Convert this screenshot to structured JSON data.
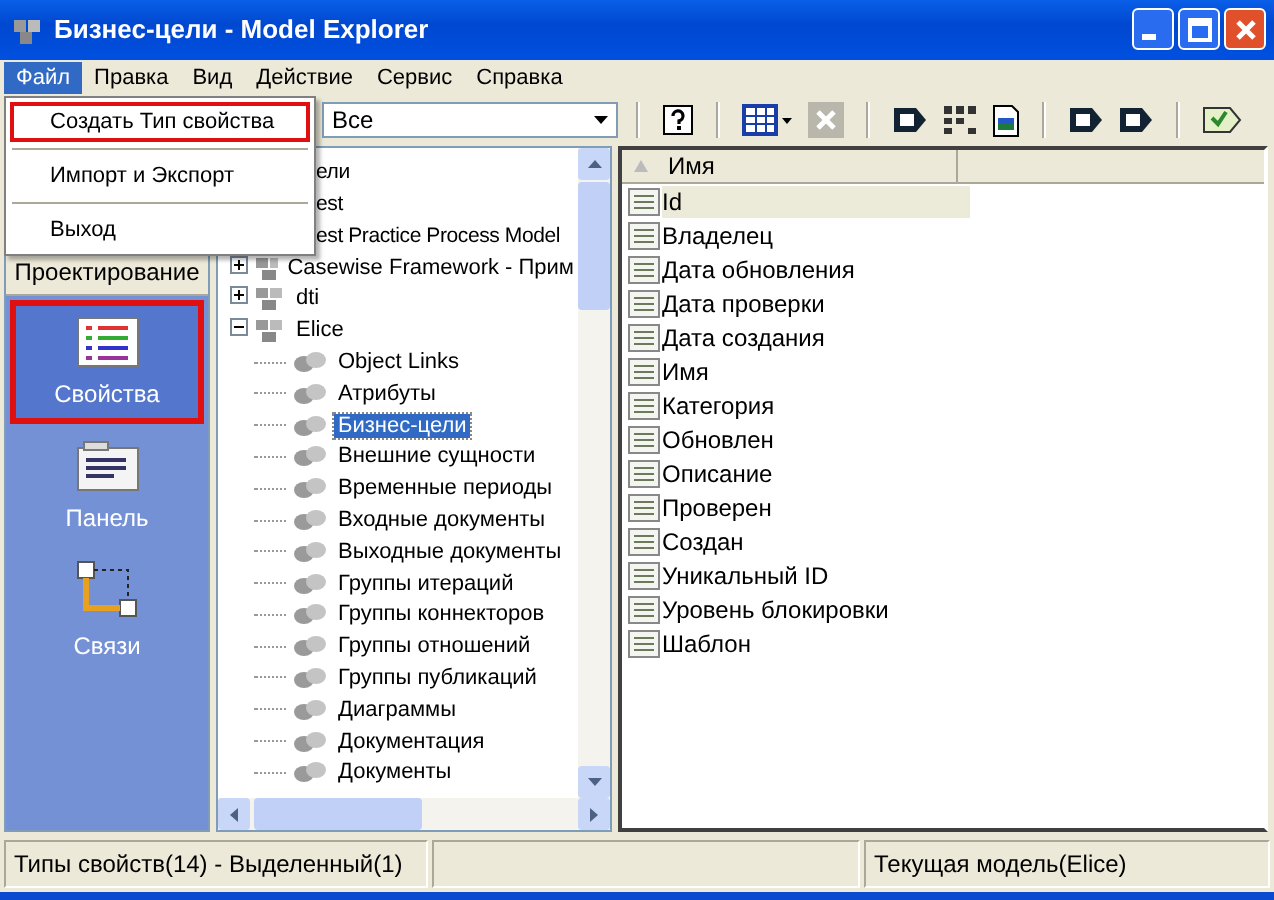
{
  "window": {
    "title": "Бизнес-цели - Model Explorer"
  },
  "menu_bar": [
    {
      "label": "Файл",
      "selected": true
    },
    {
      "label": "Правка",
      "selected": false
    },
    {
      "label": "Вид",
      "selected": false
    },
    {
      "label": "Действие",
      "selected": false
    },
    {
      "label": "Сервис",
      "selected": false
    },
    {
      "label": "Справка",
      "selected": false
    }
  ],
  "file_menu": [
    {
      "label": "Создать Тип свойства",
      "annotated": true
    },
    {
      "label": "Импорт и Экспорт",
      "annotated": false
    },
    {
      "label": "Выход",
      "annotated": false
    }
  ],
  "filter_dropdown": {
    "value": "Все"
  },
  "toolbar": [
    {
      "kind": "help"
    },
    {
      "kind": "grid"
    },
    {
      "kind": "delete",
      "disabled": true
    },
    {
      "kind": "tag"
    },
    {
      "kind": "tiles"
    },
    {
      "kind": "doc"
    },
    {
      "kind": "tag"
    },
    {
      "kind": "tag"
    },
    {
      "kind": "check"
    }
  ],
  "sidebar": {
    "header": "Проектирование",
    "items": [
      {
        "label": "Свойства",
        "kind": "list",
        "selected": true,
        "annotated": true
      },
      {
        "label": "Панель",
        "kind": "panel",
        "selected": false,
        "annotated": false
      },
      {
        "label": "Связи",
        "kind": "links",
        "selected": false,
        "annotated": false
      }
    ]
  },
  "tree": [
    {
      "label": "ели",
      "cut": true
    },
    {
      "label": "est",
      "cut": true
    },
    {
      "label": "est Practice Process Model",
      "cut": true
    },
    {
      "label": "Casewise Framework - Прим",
      "expanded": false
    },
    {
      "label": "dti",
      "expanded": false
    },
    {
      "label": "Elice",
      "expanded": true,
      "children": [
        {
          "label": "Object Links",
          "selected": false
        },
        {
          "label": "Атрибуты",
          "selected": false
        },
        {
          "label": "Бизнес-цели",
          "selected": true
        },
        {
          "label": "Внешние сущности",
          "selected": false
        },
        {
          "label": "Временные периоды",
          "selected": false
        },
        {
          "label": "Входные документы",
          "selected": false
        },
        {
          "label": "Выходные документы",
          "selected": false
        },
        {
          "label": "Группы итераций",
          "selected": false
        },
        {
          "label": "Группы коннекторов",
          "selected": false
        },
        {
          "label": "Группы отношений",
          "selected": false
        },
        {
          "label": "Группы публикаций",
          "selected": false
        },
        {
          "label": "Диаграммы",
          "selected": false
        },
        {
          "label": "Документация",
          "selected": false
        },
        {
          "label": "Документы",
          "selected": false
        }
      ]
    }
  ],
  "list": {
    "columns": [
      "Имя"
    ],
    "rows": [
      {
        "name": "Id",
        "selected": true
      },
      {
        "name": "Владелец",
        "selected": false
      },
      {
        "name": "Дата обновления",
        "selected": false
      },
      {
        "name": "Дата проверки",
        "selected": false
      },
      {
        "name": "Дата создания",
        "selected": false
      },
      {
        "name": "Имя",
        "selected": false
      },
      {
        "name": "Категория",
        "selected": false
      },
      {
        "name": "Обновлен",
        "selected": false
      },
      {
        "name": "Описание",
        "selected": false
      },
      {
        "name": "Проверен",
        "selected": false
      },
      {
        "name": "Создан",
        "selected": false
      },
      {
        "name": "Уникальный ID",
        "selected": false
      },
      {
        "name": "Уровень блокировки",
        "selected": false
      },
      {
        "name": "Шаблон",
        "selected": false
      }
    ]
  },
  "status_bar": [
    "Типы свойств(14) - Выделенный(1)",
    "Текущая модель(Elice)"
  ]
}
